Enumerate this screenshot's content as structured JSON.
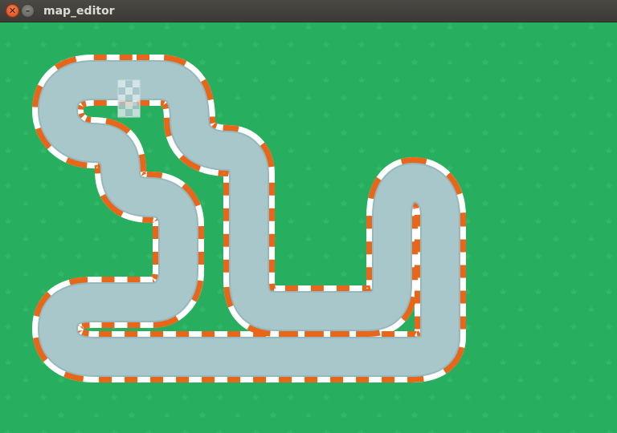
{
  "window": {
    "title": "map_editor",
    "close_icon": "close-icon",
    "minimize_icon": "minimize-icon"
  },
  "map": {
    "terrain": "grass",
    "grass_color": "#27ae5f",
    "grass_tuft_color": "#37bd6b",
    "road_color": "#a8c7cb",
    "road_edge_color": "#96b8bd",
    "curb_colors": [
      "#e8661a",
      "#ffffff"
    ],
    "start_finish": "checkered-start-line"
  }
}
